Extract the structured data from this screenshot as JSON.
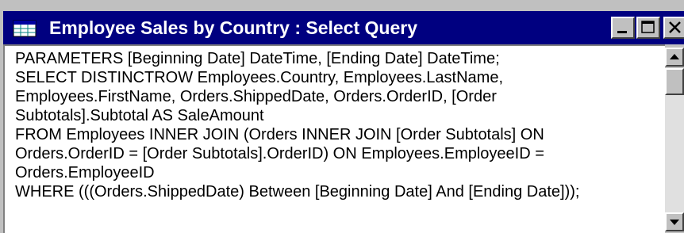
{
  "window": {
    "title": "Employee Sales by Country : Select Query",
    "icon": "query-datasheet-icon",
    "controls": {
      "minimize_icon": "minimize-icon",
      "maximize_icon": "maximize-icon",
      "close_icon": "close-icon"
    }
  },
  "editor": {
    "lines": [
      "PARAMETERS [Beginning Date] DateTime, [Ending Date] DateTime;",
      "SELECT DISTINCTROW Employees.Country, Employees.LastName,",
      "Employees.FirstName, Orders.ShippedDate, Orders.OrderID, [Order",
      "Subtotals].Subtotal AS SaleAmount",
      "FROM Employees INNER JOIN (Orders INNER JOIN [Order Subtotals] ON",
      "Orders.OrderID = [Order Subtotals].OrderID) ON Employees.EmployeeID =",
      "Orders.EmployeeID",
      "WHERE (((Orders.ShippedDate) Between [Beginning Date] And [Ending Date]));"
    ]
  },
  "scrollbar": {
    "up_icon": "scroll-up-arrow-icon",
    "down_icon": "scroll-down-arrow-icon"
  },
  "colors": {
    "titlebar": "#000080",
    "title_text": "#ffffff",
    "chrome": "#c0c0c0",
    "editor_bg": "#ffffff"
  }
}
